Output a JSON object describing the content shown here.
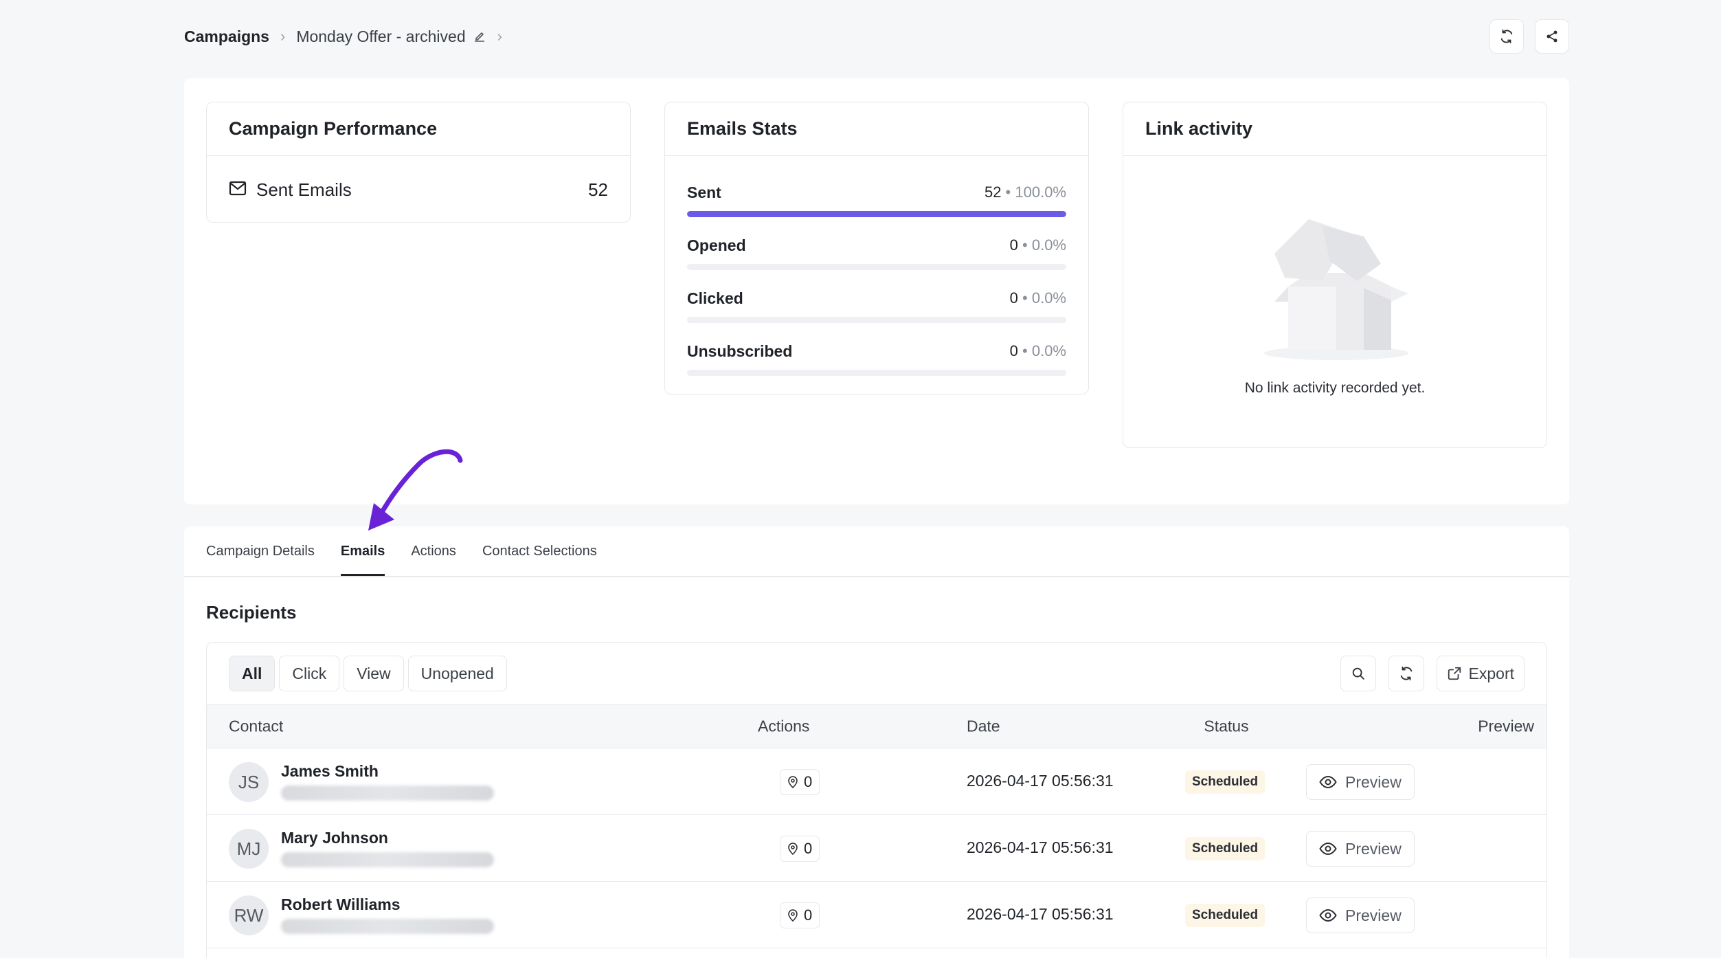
{
  "breadcrumb": {
    "root": "Campaigns",
    "current": "Monday Offer - archived"
  },
  "performance": {
    "title": "Campaign Performance",
    "sent_label": "Sent Emails",
    "sent_value": "52"
  },
  "email_stats": {
    "title": "Emails Stats",
    "rows": [
      {
        "label": "Sent",
        "count": "52",
        "pct": "100.0%",
        "fraction": 1.0
      },
      {
        "label": "Opened",
        "count": "0",
        "pct": "0.0%",
        "fraction": 0
      },
      {
        "label": "Clicked",
        "count": "0",
        "pct": "0.0%",
        "fraction": 0
      },
      {
        "label": "Unsubscribed",
        "count": "0",
        "pct": "0.0%",
        "fraction": 0
      }
    ],
    "bar_color": "#6b5ce7"
  },
  "link_activity": {
    "title": "Link activity",
    "empty_text": "No link activity recorded yet."
  },
  "tabs": [
    "Campaign Details",
    "Emails",
    "Actions",
    "Contact Selections"
  ],
  "active_tab": "Emails",
  "recipients": {
    "title": "Recipients",
    "filters": [
      "All",
      "Click",
      "View",
      "Unopened"
    ],
    "active_filter": "All",
    "export_label": "Export",
    "columns": [
      "Contact",
      "Actions",
      "Date",
      "Status",
      "Preview"
    ],
    "rows": [
      {
        "initials": "JS",
        "name": "James Smith",
        "actions": "0",
        "date": "2026-04-17 05:56:31",
        "status": "Scheduled",
        "preview": "Preview"
      },
      {
        "initials": "MJ",
        "name": "Mary Johnson",
        "actions": "0",
        "date": "2026-04-17 05:56:31",
        "status": "Scheduled",
        "preview": "Preview"
      },
      {
        "initials": "RW",
        "name": "Robert Williams",
        "actions": "0",
        "date": "2026-04-17 05:56:31",
        "status": "Scheduled",
        "preview": "Preview"
      }
    ]
  },
  "annotation_color": "#6a22d6"
}
